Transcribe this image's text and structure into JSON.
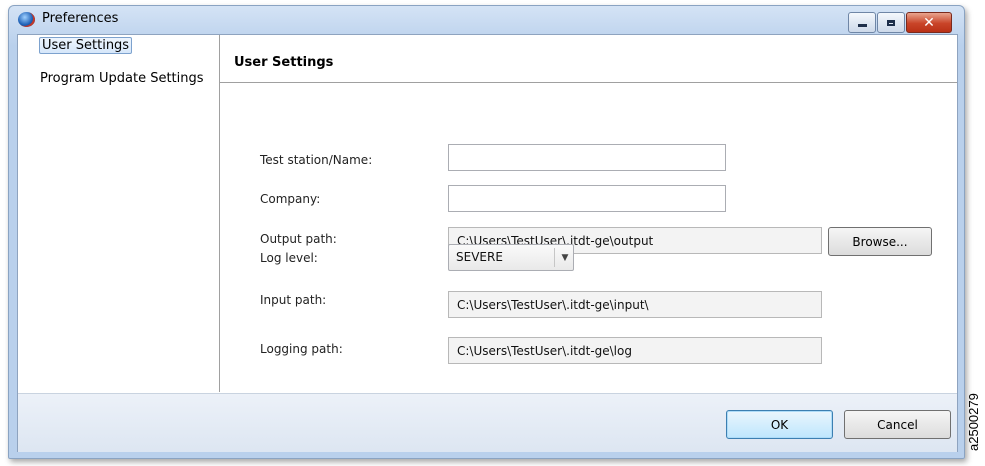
{
  "window": {
    "title": "Preferences"
  },
  "sidebar": {
    "items": [
      {
        "label": "User Settings",
        "selected": true
      },
      {
        "label": "Program Update Settings",
        "selected": false
      }
    ]
  },
  "main": {
    "title": "User Settings",
    "fields": {
      "test_station": {
        "label": "Test station/Name:",
        "value": ""
      },
      "company": {
        "label": "Company:",
        "value": ""
      },
      "output_path": {
        "label": "Output path:",
        "value": "C:\\Users\\TestUser\\.itdt-ge\\output",
        "browse_label": "Browse..."
      },
      "log_level": {
        "label": "Log level:",
        "value": "SEVERE"
      },
      "input_path": {
        "label": "Input path:",
        "value": "C:\\Users\\TestUser\\.itdt-ge\\input\\"
      },
      "logging_path": {
        "label": "Logging path:",
        "value": "C:\\Users\\TestUser\\.itdt-ge\\log"
      }
    }
  },
  "footer": {
    "ok_label": "OK",
    "cancel_label": "Cancel"
  },
  "figure_id": "a2500279",
  "colors": {
    "titlebar": "#b9d0ec",
    "close_button": "#c94428",
    "ok_button_border": "#3c7fb1",
    "divider": "#a0a0a0"
  }
}
